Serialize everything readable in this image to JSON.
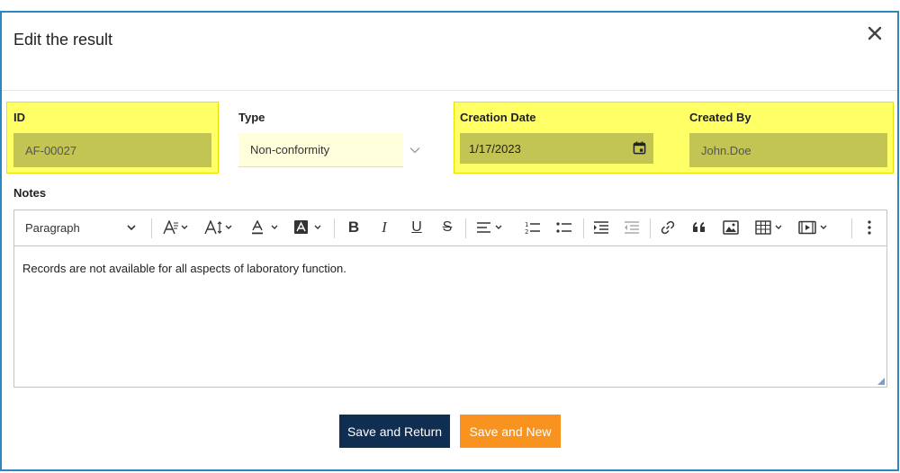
{
  "dialog": {
    "title": "Edit the result"
  },
  "form": {
    "id": {
      "label": "ID",
      "value": "AF-00027"
    },
    "type": {
      "label": "Type",
      "value": "Non-conformity"
    },
    "creation_date": {
      "label": "Creation Date",
      "value": "1/17/2023"
    },
    "created_by": {
      "label": "Created By",
      "value": "John.Doe"
    },
    "notes": {
      "label": "Notes",
      "content": "Records are not available for all aspects of laboratory function."
    }
  },
  "toolbar": {
    "paragraph_label": "Paragraph",
    "bold": "B",
    "italic": "I",
    "underline": "U",
    "strike": "S"
  },
  "buttons": {
    "save_return": "Save and Return",
    "save_new": "Save and New"
  },
  "colors": {
    "highlight": "#ffff66",
    "field_bg": "#c2c453",
    "type_bg": "#ffffdc",
    "border": "#2e86c1",
    "primary": "#102d52",
    "accent": "#f7931e"
  }
}
